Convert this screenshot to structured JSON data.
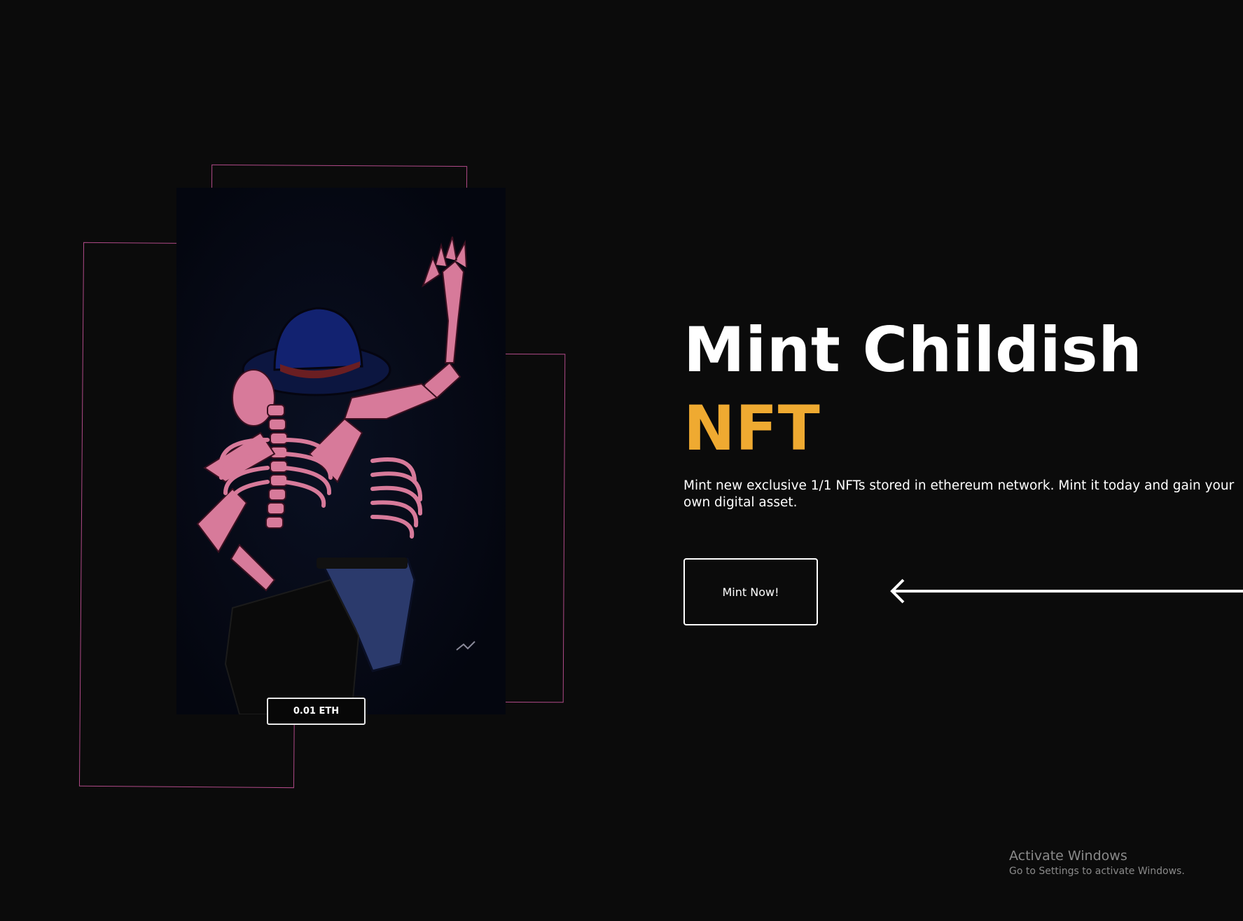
{
  "hero": {
    "title_line1": "Mint Childish",
    "title_line2": "NFT",
    "description": "Mint new exclusive 1/1 NFTs stored in ethereum network. Mint it today and gain your own digital asset.",
    "button_label": "Mint Now!"
  },
  "nft_card": {
    "price": "0.01 ETH",
    "artwork": "skeletons-dancing-artwork"
  },
  "watermark": {
    "title": "Activate Windows",
    "subtitle": "Go to Settings to activate Windows."
  },
  "colors": {
    "background": "#0b0b0b",
    "accent": "#efaa31",
    "frame": "#b04a88",
    "art_background": "#04060f",
    "bone": "#d77a9a"
  },
  "icons": {
    "arrow": "arrow-left-icon"
  }
}
